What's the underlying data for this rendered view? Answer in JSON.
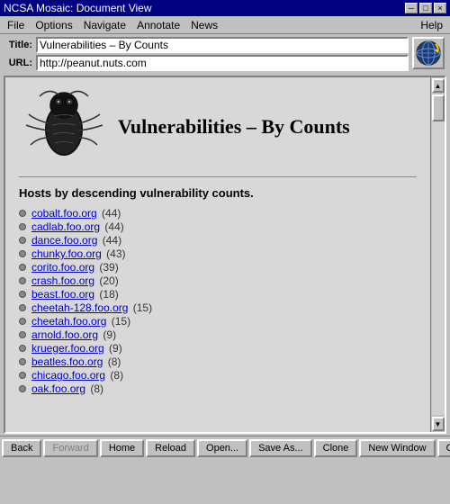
{
  "window": {
    "title": "NCSA Mosaic: Document View",
    "controls": [
      "-",
      "□",
      "×"
    ]
  },
  "menu": {
    "items": [
      "File",
      "Options",
      "Navigate",
      "Annotate",
      "News",
      "Help"
    ]
  },
  "address": {
    "title_label": "Title:",
    "title_value": "Vulnerabilities – By Counts",
    "url_label": "URL:",
    "url_value": "http://peanut.nuts.com"
  },
  "page": {
    "heading": "Vulnerabilities – By Counts",
    "subtitle": "Hosts by descending vulnerability counts.",
    "hosts": [
      {
        "name": "cobalt.foo.org",
        "count": "(44)"
      },
      {
        "name": "cadlab.foo.org",
        "count": "(44)"
      },
      {
        "name": "dance.foo.org",
        "count": "(44)"
      },
      {
        "name": "chunky.foo.org",
        "count": "(43)"
      },
      {
        "name": "corito.foo.org",
        "count": "(39)"
      },
      {
        "name": "crash.foo.org",
        "count": "(20)"
      },
      {
        "name": "beast.foo.org",
        "count": "(18)"
      },
      {
        "name": "cheetah-128.foo.org",
        "count": "(15)"
      },
      {
        "name": "cheetah.foo.org",
        "count": "(15)"
      },
      {
        "name": "arnold.foo.org",
        "count": "(9)"
      },
      {
        "name": "krueger.foo.org",
        "count": "(9)"
      },
      {
        "name": "beatles.foo.org",
        "count": "(8)"
      },
      {
        "name": "chicago.foo.org",
        "count": "(8)"
      },
      {
        "name": "oak.foo.org",
        "count": "(8)"
      }
    ]
  },
  "toolbar": {
    "buttons": [
      "Back",
      "Forward",
      "Home",
      "Reload",
      "Open...",
      "Save As...",
      "Clone",
      "New Window",
      "Close Window"
    ]
  }
}
